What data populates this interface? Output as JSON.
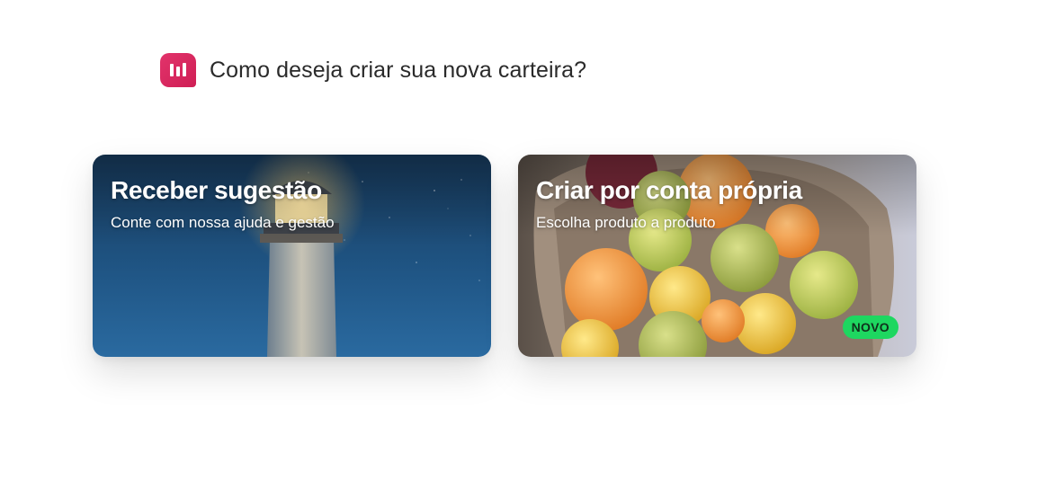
{
  "header": {
    "logo_icon": "bar-chart-icon",
    "title": "Como deseja criar sua nova carteira?"
  },
  "options": [
    {
      "title": "Receber sugestão",
      "subtitle": "Conte com nossa ajuda e gestão",
      "image": "lighthouse-night-photo"
    },
    {
      "title": "Criar por conta própria",
      "subtitle": "Escolha produto a produto",
      "image": "fruit-basket-photo",
      "badge": "NOVO"
    }
  ],
  "colors": {
    "brand": "#d82860",
    "badge_bg": "#1ed760",
    "title_text": "#2a2a2a"
  }
}
